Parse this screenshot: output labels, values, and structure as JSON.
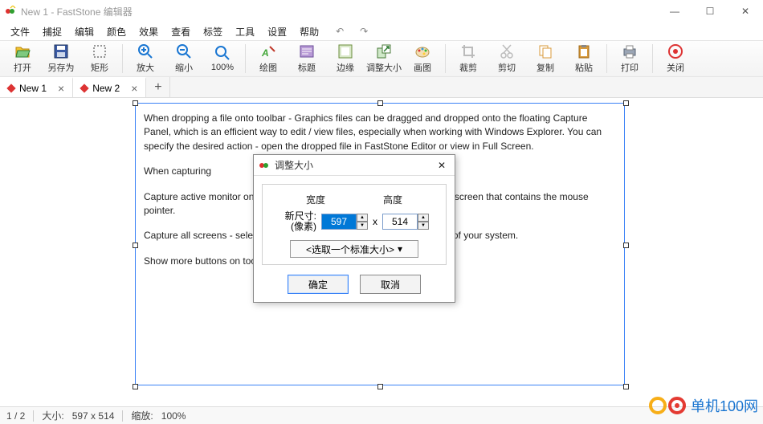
{
  "title": "New 1 - FastStone 编辑器",
  "window_buttons": {
    "min": "—",
    "max": "☐",
    "close": "✕"
  },
  "menus": [
    "文件",
    "捕捉",
    "编辑",
    "颜色",
    "效果",
    "查看",
    "标签",
    "工具",
    "设置",
    "帮助"
  ],
  "toolbar": [
    {
      "name": "open-button",
      "label": "打开"
    },
    {
      "name": "saveas-button",
      "label": "另存为"
    },
    {
      "name": "rect-select-button",
      "label": "矩形"
    },
    {
      "sep": true
    },
    {
      "name": "zoomin-button",
      "label": "放大"
    },
    {
      "name": "zoomout-button",
      "label": "缩小"
    },
    {
      "name": "zoom100-button",
      "label": "100%"
    },
    {
      "sep": true
    },
    {
      "name": "draw-button",
      "label": "绘图"
    },
    {
      "name": "caption-button",
      "label": "标题"
    },
    {
      "name": "edge-button",
      "label": "边缘"
    },
    {
      "name": "resize-button",
      "label": "调整大小"
    },
    {
      "name": "paint-button",
      "label": "画图"
    },
    {
      "sep": true
    },
    {
      "name": "crop-button",
      "label": "裁剪"
    },
    {
      "name": "cut-button",
      "label": "剪切"
    },
    {
      "name": "copy-button",
      "label": "复制"
    },
    {
      "name": "paste-button",
      "label": "粘贴"
    },
    {
      "sep": true
    },
    {
      "name": "print-button",
      "label": "打印"
    },
    {
      "sep": true
    },
    {
      "name": "close-button",
      "label": "关闭"
    }
  ],
  "tabs": [
    {
      "label": "New 1",
      "active": true
    },
    {
      "label": "New 2",
      "active": false
    }
  ],
  "doc_paragraphs": [
    "When dropping a file onto toolbar - Graphics files can be dragged and dropped onto the floating Capture Panel, which is an efficient way to edit / view files, especially when working with Windows Explorer. You can specify the desired action - open the dropped file in FastStone Editor or view in Full Screen.",
    "When capturing",
    "Capture active monitor only - select this option if you want to capture the screen that contains the mouse pointer.",
    "Capture all screens - select this option if you want to capture all screens of your system.",
    "Show more buttons on toolbar -  If you use Open File in Editor, Screen"
  ],
  "dialog": {
    "title": "调整大小",
    "newsize_label": "新尺寸:",
    "pixels_label": "(像素)",
    "width_label": "宽度",
    "height_label": "高度",
    "width_value": "597",
    "height_value": "514",
    "x": "x",
    "std_size": "<选取一个标准大小>",
    "ok": "确定",
    "cancel": "取消"
  },
  "statusbar": {
    "page": "1 / 2",
    "size_label": "大小:",
    "size_value": "597 x 514",
    "zoom_label": "缩放:",
    "zoom_value": "100%"
  },
  "watermark": {
    "site": "单机100网"
  }
}
